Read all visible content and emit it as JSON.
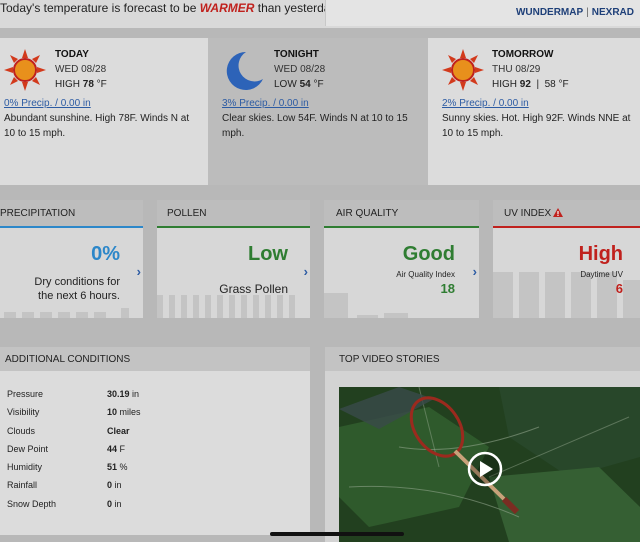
{
  "banner": {
    "text_before": "Today's temperature is forecast to be ",
    "warm_word": "WARMER",
    "text_after": " than yesterday.",
    "map_link": "WUNDERMAP",
    "separator": "|",
    "radar_link": "NEXRAD"
  },
  "forecast": [
    {
      "period": "TODAY",
      "date": "WED 08/28",
      "temp_prefix": "HIGH ",
      "temp_value": "78",
      "temp_unit": " °F",
      "precip": "0% Precip. / 0.00 in",
      "description": "Abundant sunshine. High 78F. Winds N at 10 to 15 mph.",
      "icon": "sun-icon"
    },
    {
      "period": "TONIGHT",
      "date": "WED 08/28",
      "temp_prefix": "LOW ",
      "temp_value": "54",
      "temp_unit": " °F",
      "precip": "3% Precip. / 0.00 in",
      "description": "Clear skies. Low 54F. Winds N at 10 to 15 mph.",
      "icon": "moon-icon"
    },
    {
      "period": "TOMORROW",
      "date": "THU 08/29",
      "temp_prefix": "HIGH ",
      "temp_value": "92",
      "temp_sep": "  |  58 °F",
      "precip": "2% Precip. / 0.00 in",
      "description": "Sunny skies. Hot. High 92F. Winds NNE at 10 to 15 mph.",
      "icon": "sun-icon"
    }
  ],
  "cards": {
    "precipitation": {
      "title": "PRECIPITATION",
      "value": "0%",
      "line1": "Dry conditions for",
      "line2": "the next 6 hours.",
      "color": "#2c87c9"
    },
    "pollen": {
      "title": "POLLEN",
      "value": "Low",
      "sub": "Grass Pollen",
      "color": "#2f7d32"
    },
    "air_quality": {
      "title": "AIR QUALITY",
      "value": "Good",
      "sub_label": "Air Quality Index",
      "sub_value": "18",
      "color": "#2f7d32"
    },
    "uv": {
      "title": "UV INDEX",
      "value": "High",
      "sub_label": "Daytime UV",
      "sub_value": "6",
      "color": "#c0211d",
      "alert_icon": "warning-icon"
    }
  },
  "conditions": {
    "title": "ADDITIONAL CONDITIONS",
    "rows": [
      {
        "label": "Pressure",
        "value": "30.19",
        "unit": "in"
      },
      {
        "label": "Visibility",
        "value": "10",
        "unit": "miles"
      },
      {
        "label": "Clouds",
        "value": "Clear",
        "unit": ""
      },
      {
        "label": "Dew Point",
        "value": "44",
        "unit": "F"
      },
      {
        "label": "Humidity",
        "value": "51",
        "unit": "%"
      },
      {
        "label": "Rainfall",
        "value": "0",
        "unit": "in"
      },
      {
        "label": "Snow Depth",
        "value": "0",
        "unit": "in"
      }
    ]
  },
  "video": {
    "title": "TOP VIDEO STORIES",
    "play_icon": "play-icon"
  }
}
